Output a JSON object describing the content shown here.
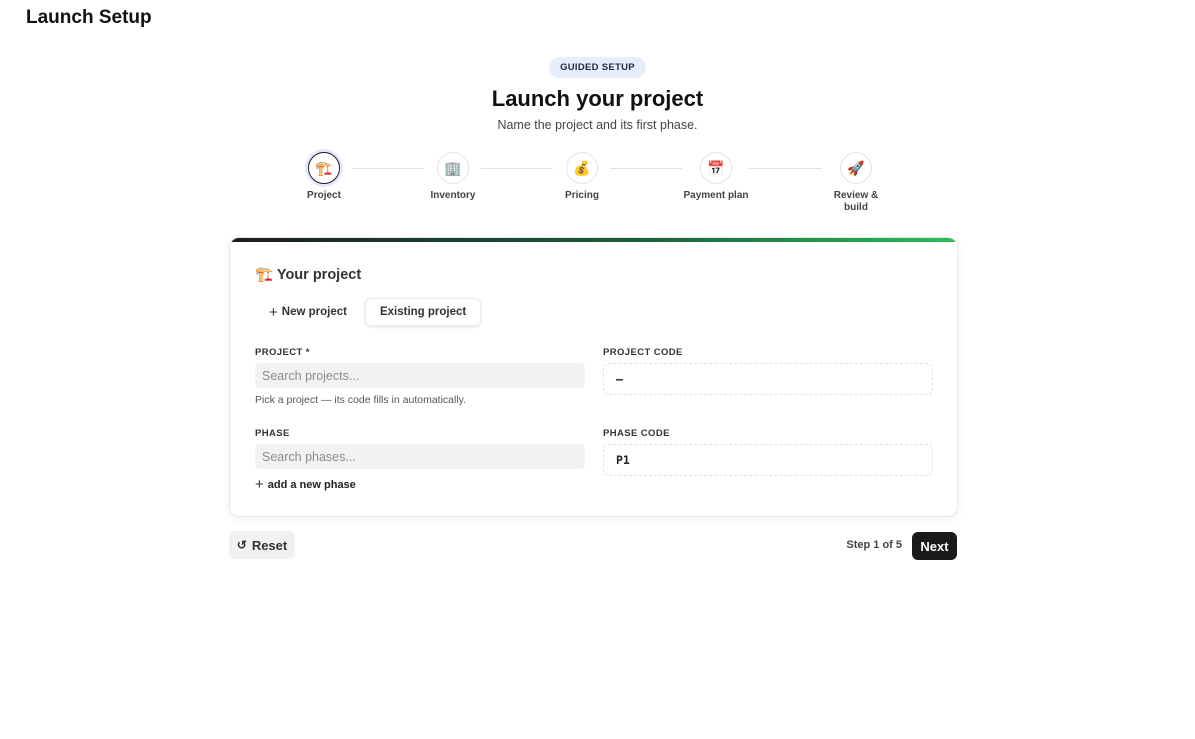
{
  "app": {
    "title": "Launch Setup"
  },
  "header": {
    "badge": "GUIDED SETUP",
    "title": "Launch your project",
    "subtitle": "Name the project and its first phase."
  },
  "steps": [
    {
      "label": "Project",
      "icon": "🏗️",
      "icon_name": "construction-icon",
      "active": true
    },
    {
      "label": "Inventory",
      "icon": "🏢",
      "icon_name": "building-icon",
      "active": false
    },
    {
      "label": "Pricing",
      "icon": "💰",
      "icon_name": "money-bag-icon",
      "active": false
    },
    {
      "label": "Payment plan",
      "icon": "📅",
      "icon_name": "calendar-icon",
      "active": false
    },
    {
      "label": "Review & build",
      "icon": "🚀",
      "icon_name": "rocket-icon",
      "active": false
    }
  ],
  "card": {
    "icon": "🏗️",
    "title": "Your project",
    "toggle": {
      "new_label": "New project",
      "existing_label": "Existing project",
      "selected": "existing"
    },
    "project": {
      "label": "PROJECT *",
      "placeholder": "Search projects...",
      "value": "",
      "hint": "Pick a project — its code fills in automatically."
    },
    "project_code": {
      "label": "PROJECT CODE",
      "value": "—"
    },
    "phase": {
      "label": "PHASE",
      "placeholder": "Search phases...",
      "value": "",
      "add_label": "add a new phase"
    },
    "phase_code": {
      "label": "PHASE CODE",
      "value": "P1"
    }
  },
  "footer": {
    "reset_label": "Reset",
    "reset_icon": "↺",
    "step_text": "Step 1 of 5",
    "next_label": "Next"
  },
  "colors": {
    "accent_dark": "#1a1a1a",
    "progress_start": "#1c1c1c",
    "progress_end": "#27c05a",
    "badge_bg": "#e6edfb"
  }
}
